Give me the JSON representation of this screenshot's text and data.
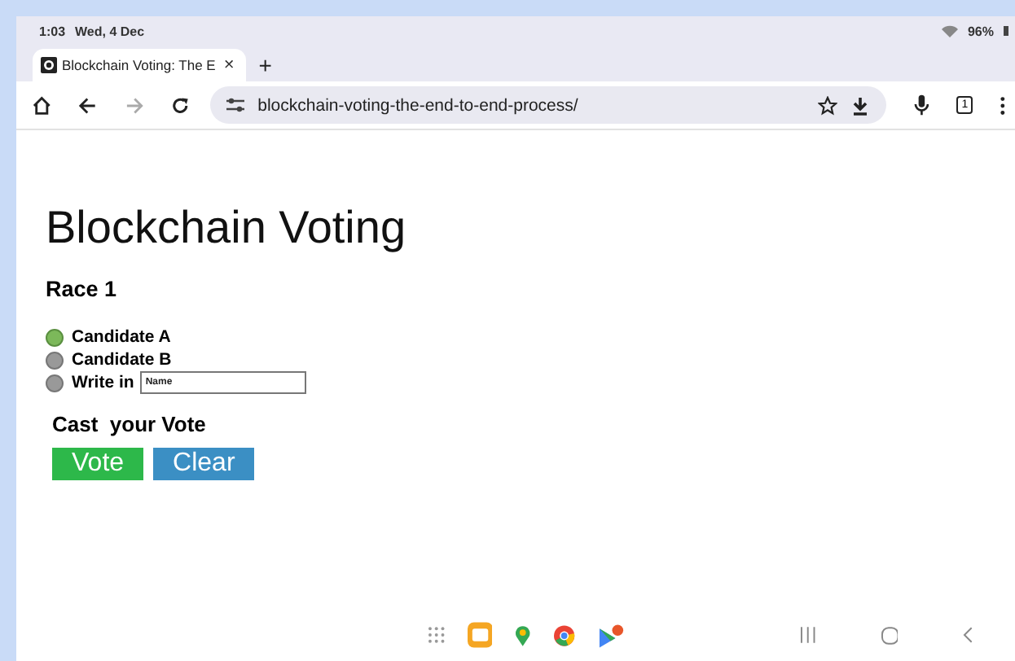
{
  "status_bar": {
    "time": "1:03",
    "date": "Wed, 4 Dec",
    "battery": "96%"
  },
  "tabs": [
    {
      "title": "Blockchain Voting: The E",
      "close": "×",
      "selected": true
    }
  ],
  "new_tab": "+",
  "address_bar": {
    "url": "blockchain-voting-the-end-to-end-process/"
  },
  "toolbar": {
    "tab_count": "1"
  },
  "page": {
    "heading": "Blockchain Voting",
    "race": "Race 1",
    "options": [
      {
        "kind": "choice",
        "label": "Candidate A",
        "selected": true
      },
      {
        "kind": "choice",
        "label": "Candidate B",
        "selected": false
      },
      {
        "kind": "write_in",
        "label": "Write in",
        "placeholder": "Name",
        "selected": false
      }
    ],
    "cast_label": "Cast  your Vote",
    "buttons": [
      {
        "label": "Vote",
        "color": "#2db84a"
      },
      {
        "label": "Clear",
        "color": "#3b8fc4"
      }
    ]
  }
}
